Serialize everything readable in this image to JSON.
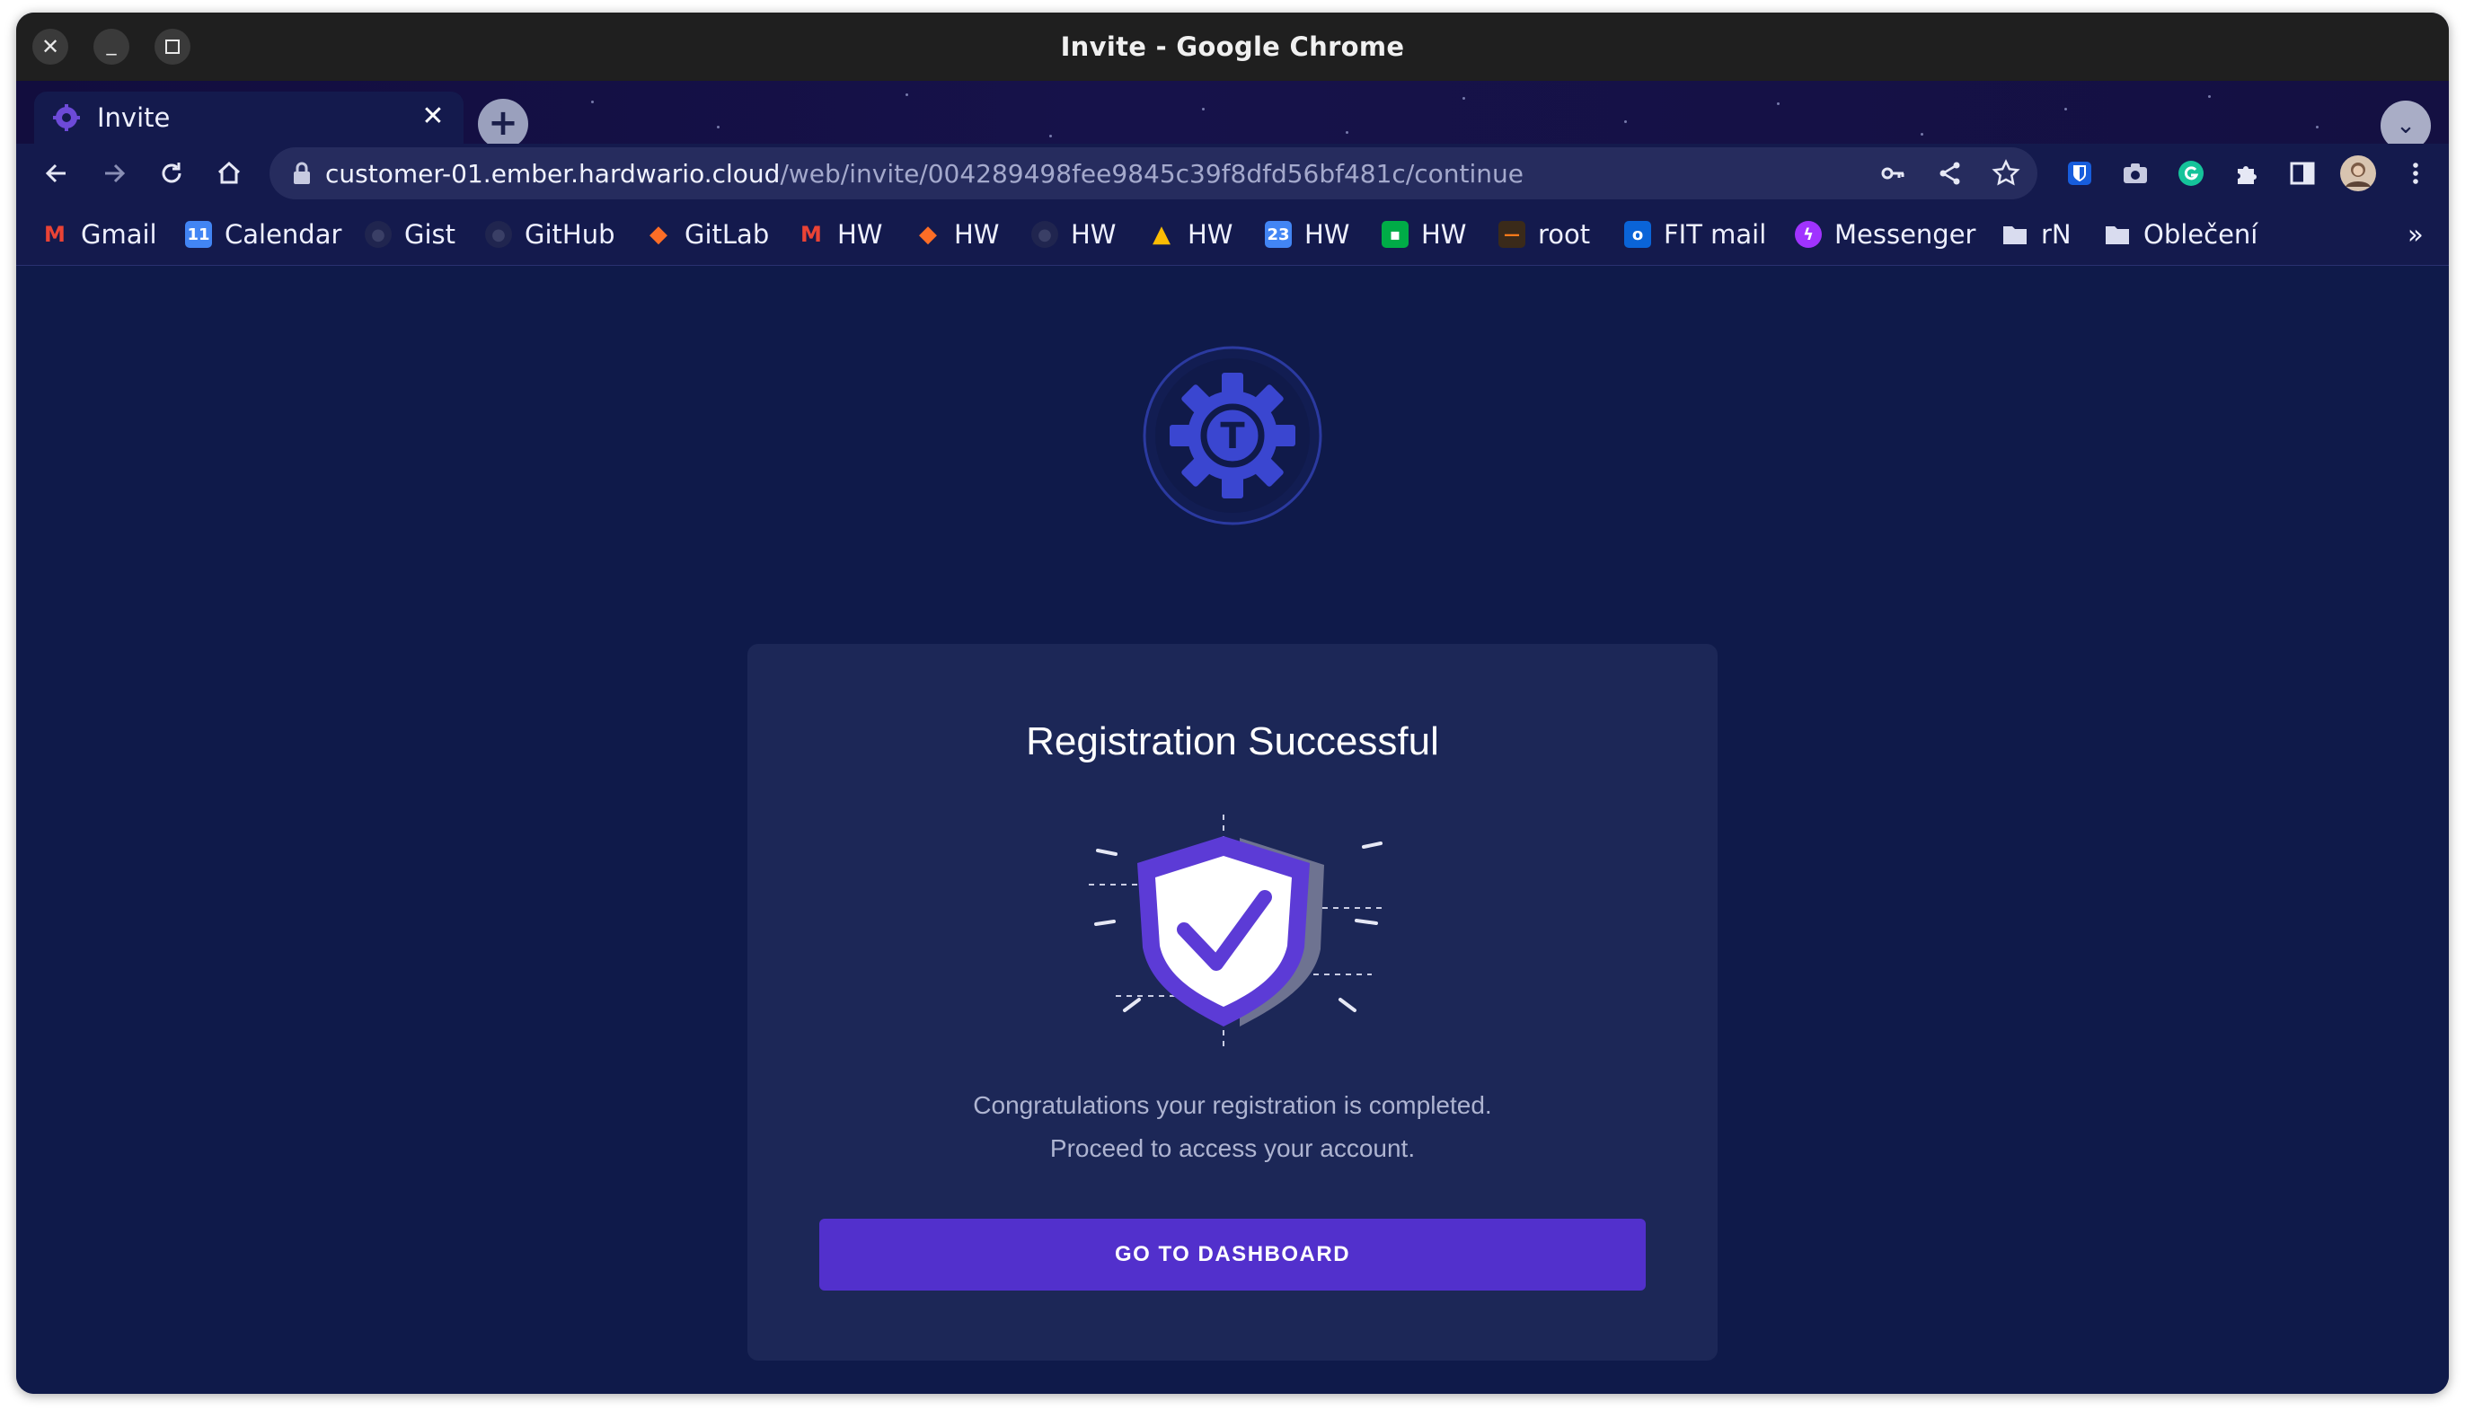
{
  "window": {
    "title": "Invite - Google Chrome"
  },
  "tabs": [
    {
      "title": "Invite",
      "favicon": "gear-favicon-icon"
    }
  ],
  "toolbar": {
    "url_host": "customer-01.ember.hardwario.cloud",
    "url_path": "/web/invite/004289498fee9845c39f8dfd56bf481c/continue"
  },
  "bookmarks": [
    {
      "label": "Gmail",
      "icon": "gmail-icon"
    },
    {
      "label": "Calendar",
      "icon": "calendar-icon"
    },
    {
      "label": "Gist",
      "icon": "github-icon"
    },
    {
      "label": "GitHub",
      "icon": "github-icon"
    },
    {
      "label": "GitLab",
      "icon": "gitlab-icon"
    },
    {
      "label": "HW",
      "icon": "gmail-icon"
    },
    {
      "label": "HW",
      "icon": "gitlab-icon"
    },
    {
      "label": "HW",
      "icon": "github-icon"
    },
    {
      "label": "HW",
      "icon": "drive-icon"
    },
    {
      "label": "HW",
      "icon": "calendar-icon"
    },
    {
      "label": "HW",
      "icon": "chat-icon"
    },
    {
      "label": "root",
      "icon": "terminal-icon"
    },
    {
      "label": "FIT mail",
      "icon": "outlook-icon"
    },
    {
      "label": "Messenger",
      "icon": "messenger-icon"
    },
    {
      "label": "rN",
      "icon": "folder-icon"
    },
    {
      "label": "Oblečení",
      "icon": "folder-icon"
    }
  ],
  "bookmarks_overflow": "»",
  "content": {
    "title": "Registration Successful",
    "message_line1": "Congratulations your registration is completed.",
    "message_line2": "Proceed to access your account.",
    "button_label": "GO TO DASHBOARD",
    "logo_letter": "T"
  },
  "colors": {
    "page_background": "#0f1a4a",
    "card_background": "#1c2757",
    "accent": "#5230cc",
    "shield": "#5c3bd6"
  }
}
